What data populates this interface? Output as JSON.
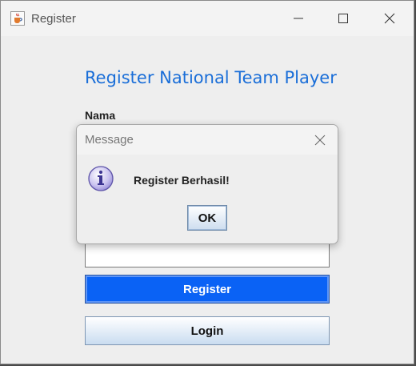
{
  "window": {
    "title": "Register",
    "icon": "java-cup-icon",
    "controls": [
      "minimize-icon",
      "maximize-icon",
      "close-icon"
    ]
  },
  "form": {
    "heading": "Register National Team Player",
    "nama_label": "Nama",
    "text_field_value": "",
    "register_button": "Register",
    "login_button": "Login"
  },
  "dialog": {
    "title": "Message",
    "icon": "info-icon",
    "message": "Register Berhasil!",
    "ok_button": "OK"
  },
  "colors": {
    "heading": "#1a6ed8",
    "register_button_bg": "#0a62f5",
    "window_bg": "#eeeeee"
  }
}
